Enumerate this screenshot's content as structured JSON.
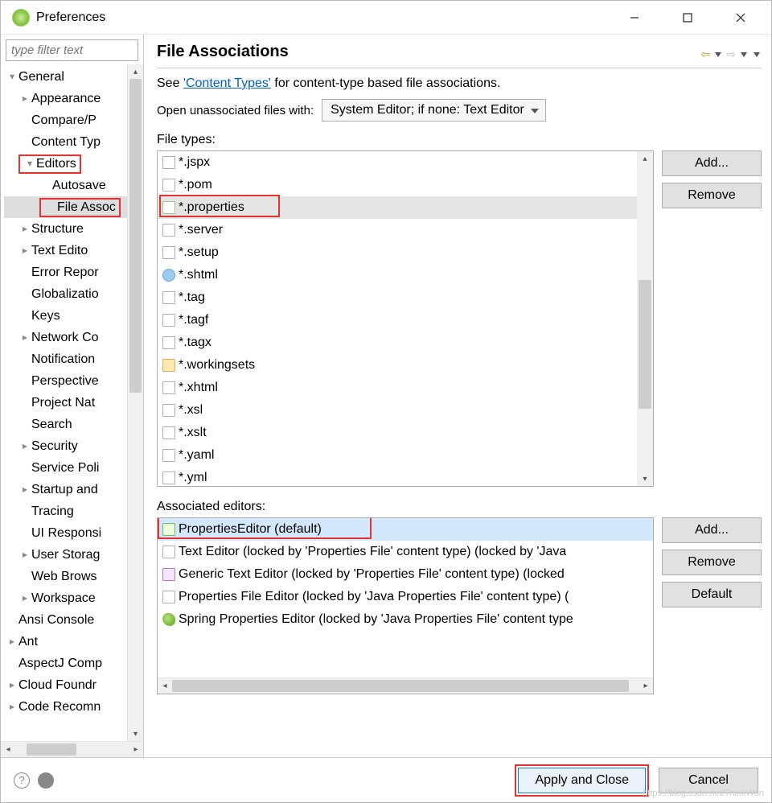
{
  "window": {
    "title": "Preferences"
  },
  "filter": {
    "placeholder": "type filter text"
  },
  "tree": [
    {
      "depth": 0,
      "arrow": "▾",
      "label": "General"
    },
    {
      "depth": 1,
      "arrow": "▸",
      "label": "Appearance"
    },
    {
      "depth": 1,
      "arrow": "",
      "label": "Compare/P"
    },
    {
      "depth": 1,
      "arrow": "",
      "label": "Content Typ"
    },
    {
      "depth": 1,
      "arrow": "▾",
      "label": "Editors",
      "red": true
    },
    {
      "depth": 2,
      "arrow": "",
      "label": "Autosave"
    },
    {
      "depth": 2,
      "arrow": "",
      "label": "File Assoc",
      "sel": true,
      "red": true
    },
    {
      "depth": 1,
      "arrow": "▸",
      "label": "Structure"
    },
    {
      "depth": 1,
      "arrow": "▸",
      "label": "Text Edito"
    },
    {
      "depth": 1,
      "arrow": "",
      "label": "Error Repor"
    },
    {
      "depth": 1,
      "arrow": "",
      "label": "Globalizatio"
    },
    {
      "depth": 1,
      "arrow": "",
      "label": "Keys"
    },
    {
      "depth": 1,
      "arrow": "▸",
      "label": "Network Co"
    },
    {
      "depth": 1,
      "arrow": "",
      "label": "Notification"
    },
    {
      "depth": 1,
      "arrow": "",
      "label": "Perspective"
    },
    {
      "depth": 1,
      "arrow": "",
      "label": "Project Nat"
    },
    {
      "depth": 1,
      "arrow": "",
      "label": "Search"
    },
    {
      "depth": 1,
      "arrow": "▸",
      "label": "Security"
    },
    {
      "depth": 1,
      "arrow": "",
      "label": "Service Poli"
    },
    {
      "depth": 1,
      "arrow": "▸",
      "label": "Startup and"
    },
    {
      "depth": 1,
      "arrow": "",
      "label": "Tracing"
    },
    {
      "depth": 1,
      "arrow": "",
      "label": "UI Responsi"
    },
    {
      "depth": 1,
      "arrow": "▸",
      "label": "User Storag"
    },
    {
      "depth": 1,
      "arrow": "",
      "label": "Web Brows"
    },
    {
      "depth": 1,
      "arrow": "▸",
      "label": "Workspace"
    },
    {
      "depth": 0,
      "arrow": "",
      "label": "Ansi Console"
    },
    {
      "depth": 0,
      "arrow": "▸",
      "label": "Ant"
    },
    {
      "depth": 0,
      "arrow": "",
      "label": "AspectJ Comp"
    },
    {
      "depth": 0,
      "arrow": "▸",
      "label": "Cloud Foundr"
    },
    {
      "depth": 0,
      "arrow": "▸",
      "label": "Code Recomn"
    }
  ],
  "page": {
    "heading": "File Associations",
    "desc_prefix": "See ",
    "desc_link": "'Content Types'",
    "desc_suffix": " for content-type based file associations.",
    "open_label": "Open unassociated files with:",
    "open_value": "System Editor; if none: Text Editor",
    "types_label": "File types:",
    "editors_label": "Associated editors:"
  },
  "buttons": {
    "add": "Add...",
    "remove": "Remove",
    "default": "Default",
    "apply_close": "Apply and Close",
    "cancel": "Cancel"
  },
  "file_types": [
    {
      "icon": "x",
      "label": "*.jspx"
    },
    {
      "icon": "x",
      "label": "*.pom"
    },
    {
      "icon": "p",
      "label": "*.properties",
      "sel": true,
      "red": true
    },
    {
      "icon": "x",
      "label": "*.server"
    },
    {
      "icon": "x",
      "label": "*.setup"
    },
    {
      "icon": "g",
      "label": "*.shtml"
    },
    {
      "icon": "x",
      "label": "*.tag"
    },
    {
      "icon": "x",
      "label": "*.tagf"
    },
    {
      "icon": "x",
      "label": "*.tagx"
    },
    {
      "icon": "f",
      "label": "*.workingsets"
    },
    {
      "icon": "x",
      "label": "*.xhtml"
    },
    {
      "icon": "x",
      "label": "*.xsl"
    },
    {
      "icon": "x",
      "label": "*.xslt"
    },
    {
      "icon": "x",
      "label": "*.yaml"
    },
    {
      "icon": "x",
      "label": "*.yml"
    }
  ],
  "editors": [
    {
      "icon": "prop",
      "label": "PropertiesEditor (default)",
      "sel": true,
      "red": true
    },
    {
      "icon": "plain",
      "label": "Text Editor (locked by 'Properties File' content type) (locked by 'Java"
    },
    {
      "icon": "purple",
      "label": "Generic Text Editor (locked by 'Properties File' content type) (locked"
    },
    {
      "icon": "plain",
      "label": "Properties File Editor (locked by 'Java Properties File' content type) ("
    },
    {
      "icon": "leaf",
      "label": "Spring Properties Editor (locked by 'Java Properties File' content type"
    }
  ],
  "watermark": "https://blog.csdn.net/ThinkWon"
}
